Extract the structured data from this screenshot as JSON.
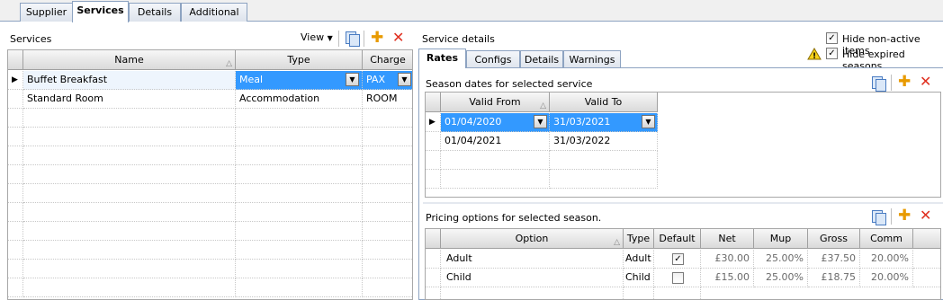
{
  "top_tabs": [
    "Supplier",
    "Services",
    "Details",
    "Additional"
  ],
  "services_panel": {
    "title": "Services",
    "view_label": "View",
    "columns": [
      "Name",
      "Type",
      "Charge"
    ],
    "rows": [
      {
        "name": "Buffet Breakfast",
        "type": "Meal",
        "charge": "PAX"
      },
      {
        "name": "Standard Room",
        "type": "Accommodation",
        "charge": "ROOM"
      }
    ]
  },
  "details_panel": {
    "title": "Service details",
    "hide_non_active_label": "Hide non-active items",
    "hide_expired_label": "Hide expired seasons",
    "hide_non_active_checked": true,
    "hide_expired_checked": true,
    "tabs": [
      "Rates",
      "Configs",
      "Details",
      "Warnings"
    ]
  },
  "seasons": {
    "title": "Season dates for selected service",
    "columns": [
      "Valid From",
      "Valid To"
    ],
    "rows": [
      {
        "from": "01/04/2020",
        "to": "31/03/2021"
      },
      {
        "from": "01/04/2021",
        "to": "31/03/2022"
      }
    ]
  },
  "pricing": {
    "title": "Pricing options for selected season.",
    "columns": [
      "Option",
      "Type",
      "Default",
      "Net",
      "Mup",
      "Gross",
      "Comm"
    ],
    "rows": [
      {
        "option": "Adult",
        "type": "Adult",
        "default": true,
        "net": "£30.00",
        "mup": "25.00%",
        "gross": "£37.50",
        "comm": "20.00%"
      },
      {
        "option": "Child",
        "type": "Child",
        "default": false,
        "net": "£15.00",
        "mup": "25.00%",
        "gross": "£18.75",
        "comm": "20.00%"
      }
    ]
  },
  "colors": {
    "selection": "#3399ff",
    "tab_border": "#8da3c1",
    "delete": "#e03020",
    "add": "#e89a00"
  }
}
